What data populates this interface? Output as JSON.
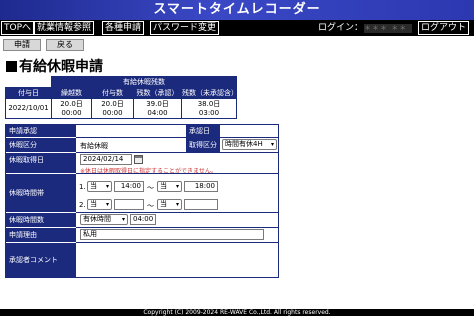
{
  "app": {
    "title": "スマートタイムレコーダー"
  },
  "menu": {
    "items": [
      "TOPへ",
      "就業情報参照",
      "各種申請",
      "パスワード変更"
    ],
    "login_label": "ログイン：",
    "login_user": "＊＊＊ ＊＊＊",
    "logout_label": "ログアウト"
  },
  "actions": {
    "apply_label": "申請",
    "back_label": "戻る"
  },
  "page": {
    "title": "有給休暇申請"
  },
  "summary": {
    "caption": "有給休暇残数",
    "headers": [
      "付与日",
      "繰越数",
      "付与数",
      "残数（承認）",
      "残数（未承認含）"
    ],
    "row": [
      "2022/10/01",
      "20.0日\n00:00",
      "20.0日\n00:00",
      "39.0日\n04:00",
      "38.0日\n03:00"
    ]
  },
  "form": {
    "labels": {
      "approval": "申請承認",
      "approval_date": "承認日",
      "leave_type": "休暇区分",
      "acquisition_type": "取得区分",
      "leave_date": "休暇取得日",
      "time_range": "休暇時間帯",
      "hours": "休暇時間数",
      "reason": "申請理由",
      "approver_comment": "承認者コメント"
    },
    "leave_type_value": "有給休暇",
    "acquisition_value": "時間有休4H",
    "leave_date_value": "2024/02/14",
    "date_note": "※休日は休暇取得日に指定することができません。",
    "time_rows": [
      {
        "prefix": "1.",
        "day": "当",
        "start": "14:00",
        "sep": "～",
        "end_day": "当",
        "end": "18:00"
      },
      {
        "prefix": "2.",
        "day": "当",
        "start": "",
        "sep": "～",
        "end_day": "当",
        "end": ""
      }
    ],
    "hours_type": "有休時間",
    "hours_value": "04:00",
    "reason_value": "私用",
    "approver_comment_value": ""
  },
  "footer": {
    "copyright": "Copyright (C) 2009-2024 RE-WAVE Co.,Ltd. All rights reserved."
  }
}
